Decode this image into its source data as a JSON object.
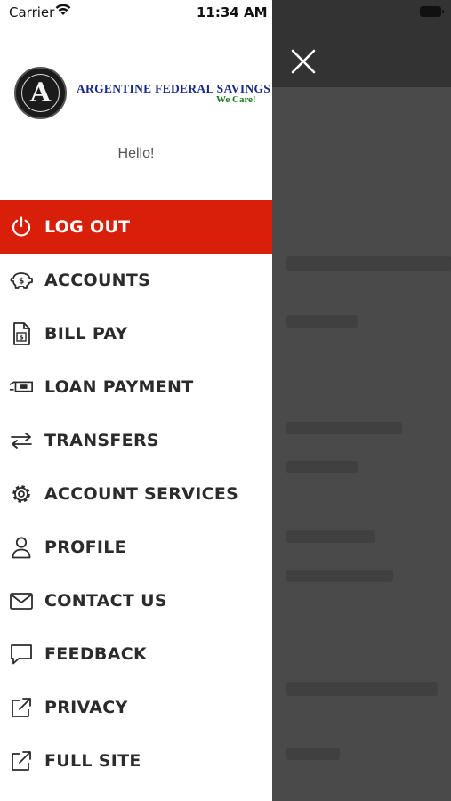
{
  "status_bar": {
    "carrier": "Carrier",
    "time": "11:34 AM"
  },
  "brand": {
    "name": "ARGENTINE FEDERAL SAVINGS",
    "tagline": "We Care!",
    "seal_letter": "A"
  },
  "greeting": "Hello!",
  "menu": {
    "items": [
      {
        "label": "LOG OUT",
        "icon": "power-icon",
        "active": true
      },
      {
        "label": "ACCOUNTS",
        "icon": "piggy-bank-icon"
      },
      {
        "label": "BILL PAY",
        "icon": "bill-document-icon"
      },
      {
        "label": "LOAN PAYMENT",
        "icon": "cash-payment-icon"
      },
      {
        "label": "TRANSFERS",
        "icon": "transfer-arrows-icon"
      },
      {
        "label": "ACCOUNT SERVICES",
        "icon": "gear-icon"
      },
      {
        "label": "PROFILE",
        "icon": "person-icon"
      },
      {
        "label": "CONTACT US",
        "icon": "envelope-icon"
      },
      {
        "label": "FEEDBACK",
        "icon": "speech-bubble-icon"
      },
      {
        "label": "PRIVACY",
        "icon": "external-link-icon"
      },
      {
        "label": "FULL SITE",
        "icon": "external-link-icon"
      }
    ]
  },
  "colors": {
    "active_bg": "#d71f0a",
    "brand_blue": "#1a2a86",
    "brand_green": "#1a7a1a",
    "overlay": "#4a4a4a"
  }
}
